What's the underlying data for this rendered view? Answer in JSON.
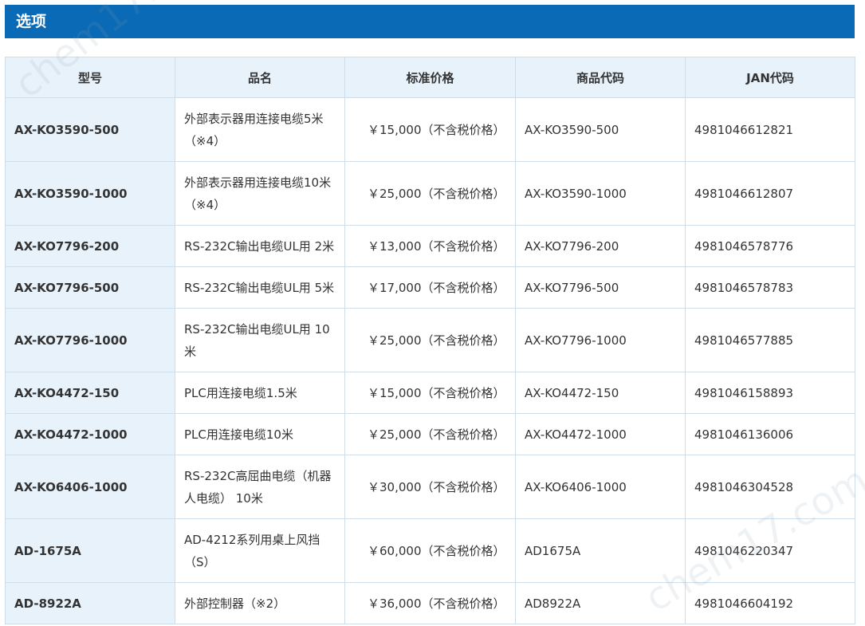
{
  "section": {
    "title": "选项"
  },
  "table": {
    "headers": [
      "型号",
      "品名",
      "标准价格",
      "商品代码",
      "JAN代码"
    ],
    "rows": [
      {
        "model": "AX-KO3590-500",
        "name": "外部表示器用连接电缆5米（※4）",
        "price": "￥15,000（不含税价格）",
        "code": "AX-KO3590-500",
        "jan": "4981046612821"
      },
      {
        "model": "AX-KO3590-1000",
        "name": "外部表示器用连接电缆10米（※4）",
        "price": "￥25,000（不含税价格）",
        "code": "AX-KO3590-1000",
        "jan": "4981046612807"
      },
      {
        "model": "AX-KO7796-200",
        "name": "RS-232C输出电缆UL用 2米",
        "price": "￥13,000（不含税价格）",
        "code": "AX-KO7796-200",
        "jan": "4981046578776"
      },
      {
        "model": "AX-KO7796-500",
        "name": "RS-232C输出电缆UL用 5米",
        "price": "￥17,000（不含税价格）",
        "code": "AX-KO7796-500",
        "jan": "4981046578783"
      },
      {
        "model": "AX-KO7796-1000",
        "name": "RS-232C输出电缆UL用 10米",
        "price": "￥25,000（不含税价格）",
        "code": "AX-KO7796-1000",
        "jan": "4981046577885"
      },
      {
        "model": "AX-KO4472-150",
        "name": "PLC用连接电缆1.5米",
        "price": "￥15,000（不含税价格）",
        "code": "AX-KO4472-150",
        "jan": "4981046158893"
      },
      {
        "model": "AX-KO4472-1000",
        "name": "PLC用连接电缆10米",
        "price": "￥25,000（不含税价格）",
        "code": "AX-KO4472-1000",
        "jan": "4981046136006"
      },
      {
        "model": "AX-KO6406-1000",
        "name": "RS-232C高屈曲电缆（机器人电缆） 10米",
        "price": "￥30,000（不含税价格）",
        "code": "AX-KO6406-1000",
        "jan": "4981046304528"
      },
      {
        "model": "AD-1675A",
        "name": "AD-4212系列用桌上风挡（S）",
        "price": "￥60,000（不含税价格）",
        "code": "AD1675A",
        "jan": "4981046220347"
      },
      {
        "model": "AD-8922A",
        "name": "外部控制器（※2）",
        "price": "￥36,000（不含税价格）",
        "code": "AD8922A",
        "jan": "4981046604192"
      }
    ]
  },
  "watermark": {
    "text": "chem17.com"
  }
}
